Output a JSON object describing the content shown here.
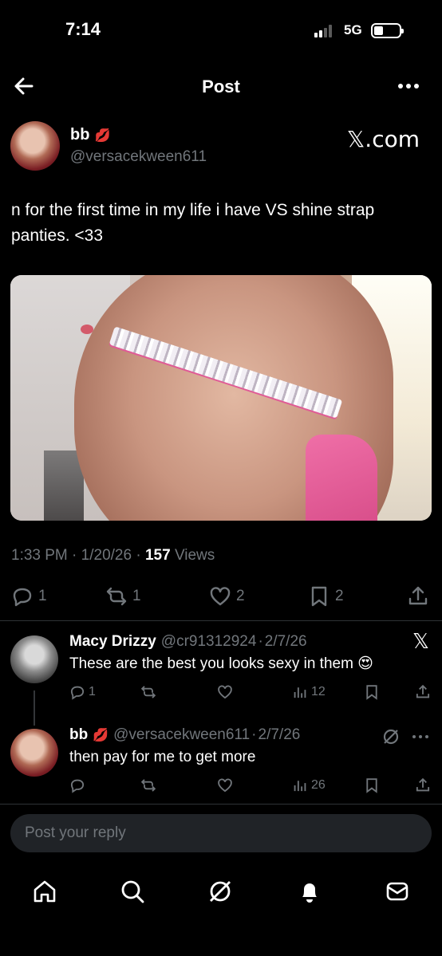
{
  "status_bar": {
    "time": "7:14",
    "network": "5G",
    "battery_level": 0.35
  },
  "header": {
    "title": "Post",
    "back_icon": "arrow-left-icon",
    "more_icon": "more-horizontal-icon"
  },
  "post": {
    "author_name": "bb",
    "author_emoji": "💋",
    "author_handle": "@versacekween611",
    "source_label": "𝕏.com",
    "text": "n for the first time in my life i have VS shine strap panties. <33",
    "time": "1:33 PM",
    "date": "1/20/26",
    "views_count": "157",
    "views_label": "Views",
    "stats": {
      "replies": "1",
      "reposts": "1",
      "likes": "2",
      "bookmarks": "2"
    }
  },
  "replies": [
    {
      "name": "Macy Drizzy",
      "handle": "@cr91312924",
      "date": "2/7/26",
      "text": "These are the best you looks sexy in them 😍",
      "stats": {
        "replies": "1",
        "views": "12"
      },
      "badge": "𝕏"
    },
    {
      "name": "bb",
      "emoji": "💋",
      "handle": "@versacekween611",
      "date": "2/7/26",
      "text": "then pay for me to get more",
      "stats": {
        "views": "26"
      }
    }
  ],
  "composer": {
    "placeholder": "Post your reply"
  },
  "bottom_nav": [
    "home-icon",
    "search-icon",
    "grok-icon",
    "notifications-icon",
    "messages-icon"
  ],
  "colors": {
    "background": "#000000",
    "muted": "#71767b",
    "text": "#e7e9ea",
    "divider": "#2f3336"
  }
}
